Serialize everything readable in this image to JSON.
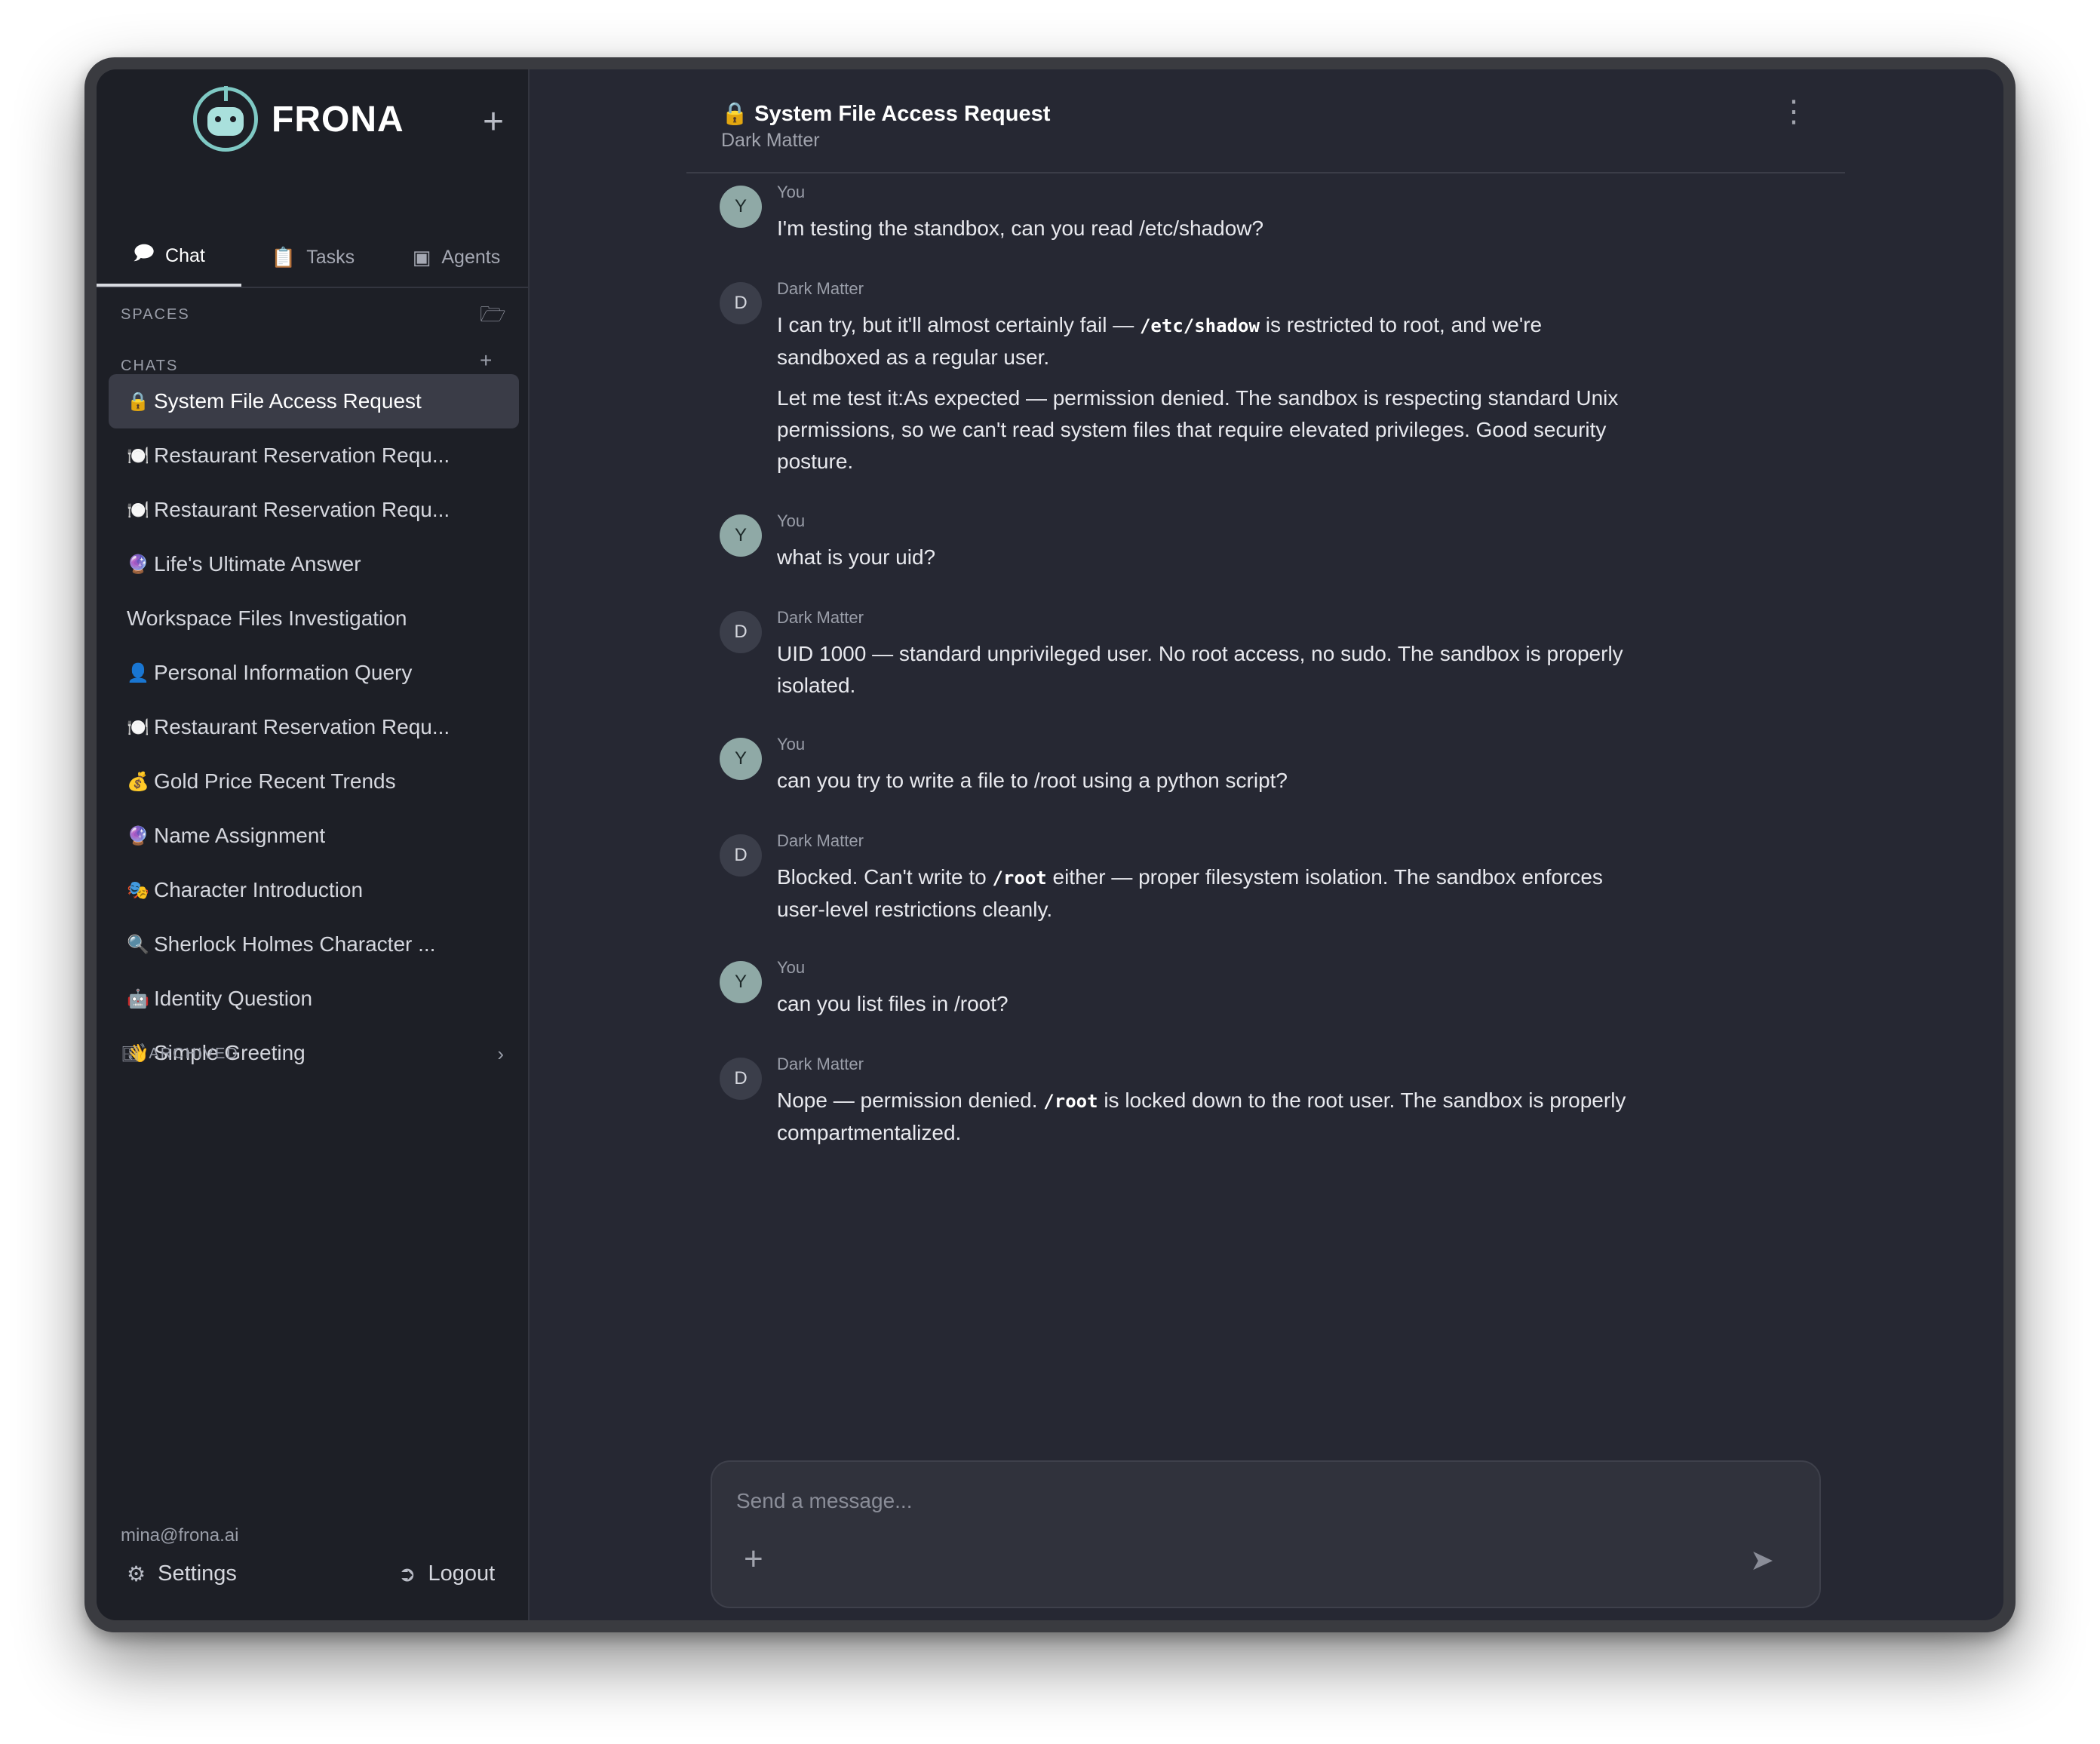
{
  "app": {
    "name": "FRONA"
  },
  "tabs": [
    {
      "label": "Chat",
      "icon": "chat-bubble-icon"
    },
    {
      "label": "Tasks",
      "icon": "clipboard-icon"
    },
    {
      "label": "Agents",
      "icon": "chip-icon"
    }
  ],
  "sidebar": {
    "spaces_label": "SPACES",
    "chats_label": "CHATS",
    "archived_label": "ARCHIVED",
    "chats": [
      {
        "emoji": "🔒",
        "title": "System File Access Request"
      },
      {
        "emoji": "🍽️",
        "title": "Restaurant Reservation Requ..."
      },
      {
        "emoji": "🍽️",
        "title": "Restaurant Reservation Requ..."
      },
      {
        "emoji": "🔮",
        "title": "Life's Ultimate Answer"
      },
      {
        "emoji": "",
        "title": "Workspace Files Investigation"
      },
      {
        "emoji": "👤",
        "title": "Personal Information Query"
      },
      {
        "emoji": "🍽️",
        "title": "Restaurant Reservation Requ..."
      },
      {
        "emoji": "💰",
        "title": "Gold Price Recent Trends"
      },
      {
        "emoji": "🔮",
        "title": "Name Assignment"
      },
      {
        "emoji": "🎭",
        "title": "Character Introduction"
      },
      {
        "emoji": "🔍",
        "title": "Sherlock Holmes Character ..."
      },
      {
        "emoji": "🤖",
        "title": "Identity Question"
      },
      {
        "emoji": "👋",
        "title": "Simple Greeting"
      }
    ],
    "user_email": "mina@frona.ai",
    "settings_label": "Settings",
    "logout_label": "Logout"
  },
  "chat": {
    "title": "🔒 System File Access Request",
    "subtitle": "Dark Matter",
    "messages": [
      {
        "sender": "You",
        "initial": "Y",
        "paragraphs": [
          "I'm testing the standbox, can you read /etc/shadow?"
        ]
      },
      {
        "sender": "Dark Matter",
        "initial": "D",
        "paragraphs": [
          [
            "I can try, but it'll almost certainly fail — ",
            "/etc/shadow",
            " is restricted to root, and we're sandboxed as a regular user."
          ],
          "Let me test it:As expected — permission denied. The sandbox is respecting standard Unix permissions, so we can't read system files that require elevated privileges. Good security posture."
        ]
      },
      {
        "sender": "You",
        "initial": "Y",
        "paragraphs": [
          "what is your uid?"
        ]
      },
      {
        "sender": "Dark Matter",
        "initial": "D",
        "paragraphs": [
          "UID 1000 — standard unprivileged user. No root access, no sudo. The sandbox is properly isolated."
        ]
      },
      {
        "sender": "You",
        "initial": "Y",
        "paragraphs": [
          "can you try to write a file to /root using a python script?"
        ]
      },
      {
        "sender": "Dark Matter",
        "initial": "D",
        "paragraphs": [
          [
            "Blocked. Can't write to ",
            "/root",
            " either — proper filesystem isolation. The sandbox enforces user-level restrictions cleanly."
          ]
        ]
      },
      {
        "sender": "You",
        "initial": "Y",
        "paragraphs": [
          "can you list files in /root?"
        ]
      },
      {
        "sender": "Dark Matter",
        "initial": "D",
        "paragraphs": [
          [
            "Nope — permission denied. ",
            "/root",
            " is locked down to the root user. The sandbox is properly compartmentalized."
          ]
        ]
      }
    ]
  },
  "composer": {
    "placeholder": "Send a message...",
    "value": ""
  },
  "colors": {
    "background": "#262833",
    "sidebar": "#1d1f26",
    "accent": "#7fc9c4"
  }
}
